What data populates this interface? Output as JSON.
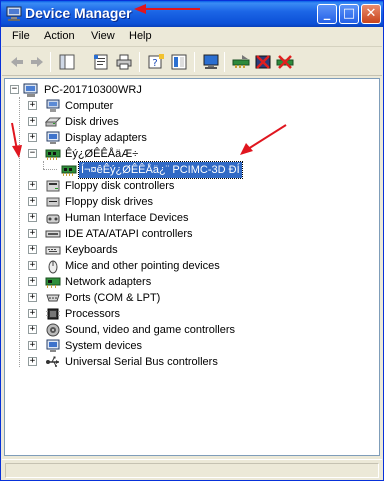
{
  "window": {
    "title": "Device Manager",
    "controls": {
      "minimize": "_",
      "maximize": "□",
      "close": "✕"
    }
  },
  "menu": [
    "File",
    "Action",
    "View",
    "Help"
  ],
  "toolbar": {
    "icons": [
      "back-arrow-icon",
      "forward-arrow-icon",
      "properties-icon",
      "print-icon",
      "help-icon",
      "show-hide-tree-icon",
      "scan-hardware-icon",
      "update-driver-icon",
      "uninstall-icon",
      "disable-icon"
    ]
  },
  "tree": {
    "root": "PC-201710300WRJ",
    "items": [
      {
        "label": "Computer",
        "icon": "computer-icon",
        "expander": "+"
      },
      {
        "label": "Disk drives",
        "icon": "disk-drive-icon",
        "expander": "+"
      },
      {
        "label": "Display adapters",
        "icon": "display-adapter-icon",
        "expander": "+"
      },
      {
        "label": "Êý¿ØÊÊÅäÆ÷",
        "icon": "controller-card-icon",
        "expander": "−"
      },
      {
        "label": "Í¬¤êÊý¿ØÊÊÅä¿¨ PCIMC-3D ÐÍ",
        "icon": "controller-card-icon",
        "expander": "",
        "child": true,
        "selected": true
      },
      {
        "label": "Floppy disk controllers",
        "icon": "floppy-controller-icon",
        "expander": "+"
      },
      {
        "label": "Floppy disk drives",
        "icon": "floppy-drive-icon",
        "expander": "+"
      },
      {
        "label": "Human Interface Devices",
        "icon": "hid-icon",
        "expander": "+"
      },
      {
        "label": "IDE ATA/ATAPI controllers",
        "icon": "ide-controller-icon",
        "expander": "+"
      },
      {
        "label": "Keyboards",
        "icon": "keyboard-icon",
        "expander": "+"
      },
      {
        "label": "Mice and other pointing devices",
        "icon": "mouse-icon",
        "expander": "+"
      },
      {
        "label": "Network adapters",
        "icon": "network-adapter-icon",
        "expander": "+"
      },
      {
        "label": "Ports (COM & LPT)",
        "icon": "port-icon",
        "expander": "+"
      },
      {
        "label": "Processors",
        "icon": "processor-icon",
        "expander": "+"
      },
      {
        "label": "Sound, video and game controllers",
        "icon": "sound-icon",
        "expander": "+"
      },
      {
        "label": "System devices",
        "icon": "system-device-icon",
        "expander": "+"
      },
      {
        "label": "Universal Serial Bus controllers",
        "icon": "usb-icon",
        "expander": "+"
      }
    ]
  },
  "colors": {
    "titlebar": "#0a4fd6",
    "selection": "#316ac5",
    "annotation": "#e0161f"
  }
}
